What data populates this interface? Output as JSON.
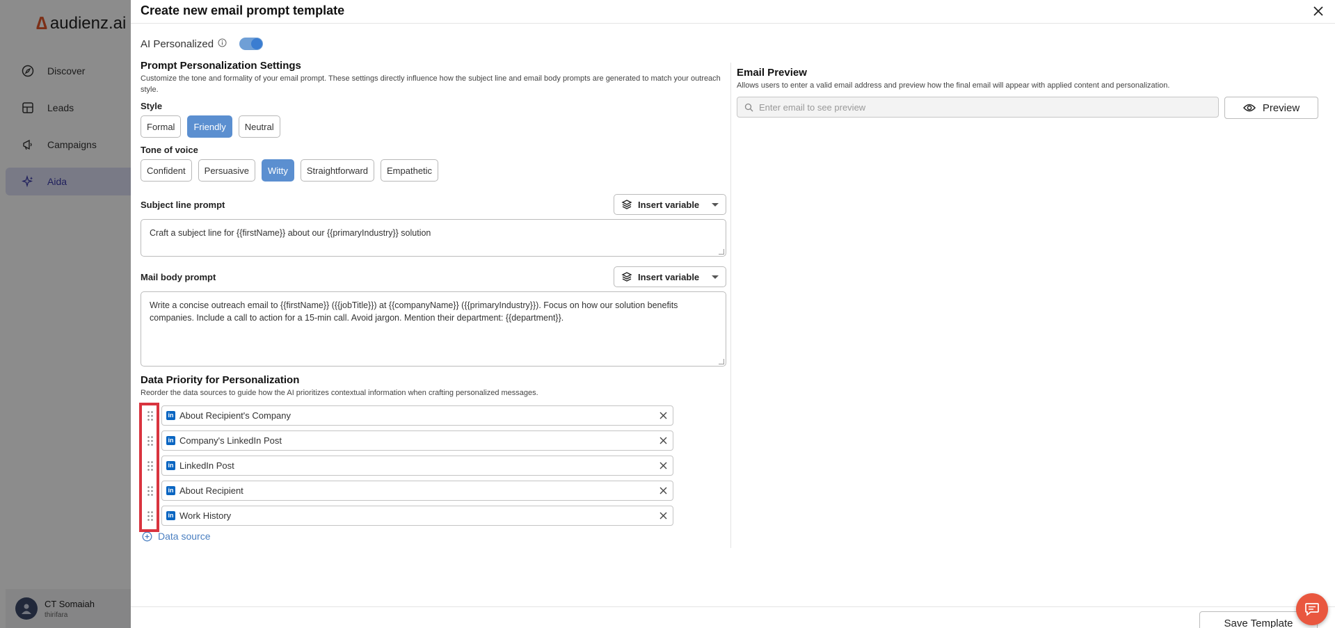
{
  "app": {
    "logo_text": "audienz.ai",
    "nav": [
      {
        "label": "Discover",
        "icon": "compass-icon"
      },
      {
        "label": "Leads",
        "icon": "grid-icon"
      },
      {
        "label": "Campaigns",
        "icon": "megaphone-icon"
      },
      {
        "label": "Aida",
        "icon": "sparkle-icon",
        "active": true
      }
    ],
    "user": {
      "name": "CT Somaiah",
      "org": "thirifara"
    }
  },
  "modal": {
    "title": "Create new email prompt template",
    "ai_personalized_label": "AI Personalized",
    "ai_personalized_on": true,
    "settings": {
      "title": "Prompt Personalization Settings",
      "description": "Customize the tone and formality of your email prompt. These settings directly influence how the subject line and email body prompts are generated to match your outreach style.",
      "style_label": "Style",
      "styles": [
        "Formal",
        "Friendly",
        "Neutral"
      ],
      "style_selected": "Friendly",
      "tone_label": "Tone of voice",
      "tones": [
        "Confident",
        "Persuasive",
        "Witty",
        "Straightforward",
        "Empathetic"
      ],
      "tone_selected": "Witty"
    },
    "subject": {
      "label": "Subject line prompt",
      "insert_label": "Insert variable",
      "value": "Craft a subject line for {{firstName}} about our {{primaryIndustry}} solution"
    },
    "body": {
      "label": "Mail body prompt",
      "insert_label": "Insert variable",
      "value": "Write a concise outreach email to {{firstName}} ({{jobTitle}}) at {{companyName}} ({{primaryIndustry}}). Focus on how our solution benefits companies. Include a call to action for a 15-min call. Avoid jargon. Mention their department: {{department}}."
    },
    "priority": {
      "title": "Data Priority for Personalization",
      "description": "Reorder the data sources to guide how the AI prioritizes contextual information when crafting personalized messages.",
      "sources": [
        "About Recipient's Company",
        "Company's LinkedIn Post",
        "LinkedIn Post",
        "About Recipient",
        "Work History"
      ],
      "source_badge": "in",
      "add_label": "Data source"
    },
    "preview": {
      "title": "Email Preview",
      "description": "Allows users to enter a valid email address and preview how the final email will appear with applied content and personalization.",
      "placeholder": "Enter email to see preview",
      "button_label": "Preview"
    },
    "save_label": "Save Template"
  },
  "colors": {
    "accent": "#5b8fd0",
    "highlight": "#d9343f",
    "chat": "#e9573f",
    "linkedin": "#0a66c2"
  }
}
